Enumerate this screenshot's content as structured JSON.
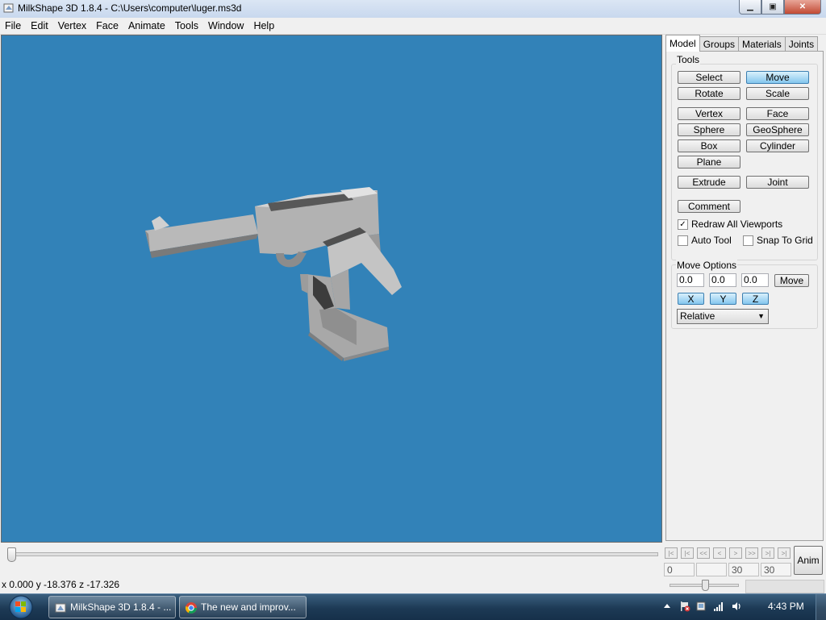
{
  "window": {
    "title": "MilkShape 3D 1.8.4 - C:\\Users\\computer\\luger.ms3d",
    "minimize_label": "▁",
    "maximize_label": "▣",
    "close_label": "✕"
  },
  "menu": [
    "File",
    "Edit",
    "Vertex",
    "Face",
    "Animate",
    "Tools",
    "Window",
    "Help"
  ],
  "panel": {
    "tabs": [
      "Model",
      "Groups",
      "Materials",
      "Joints"
    ],
    "active_tab": "Model",
    "tools_label": "Tools",
    "tool_buttons": {
      "select": "Select",
      "move": "Move",
      "rotate": "Rotate",
      "scale": "Scale",
      "vertex": "Vertex",
      "face": "Face",
      "sphere": "Sphere",
      "geosphere": "GeoSphere",
      "box": "Box",
      "cylinder": "Cylinder",
      "plane": "Plane",
      "extrude": "Extrude",
      "joint": "Joint",
      "comment": "Comment"
    },
    "active_tool": "Move",
    "redraw_all_viewports": {
      "label": "Redraw All Viewports",
      "checked": true,
      "mark": "✓"
    },
    "auto_tool": {
      "label": "Auto Tool",
      "checked": false
    },
    "snap_to_grid": {
      "label": "Snap To Grid",
      "checked": false
    },
    "move_options": {
      "label": "Move Options",
      "x_value": "0.0",
      "y_value": "0.0",
      "z_value": "0.0",
      "move_button": "Move",
      "x_toggle": "X",
      "y_toggle": "Y",
      "z_toggle": "Z",
      "mode": "Relative",
      "dropdown_arrow": "▼"
    }
  },
  "timeline": {
    "nav_buttons": [
      "|<",
      "|<",
      "<<",
      "<",
      ">",
      ">>",
      ">|",
      ">|"
    ],
    "current_frame": "0",
    "frame_fields": [
      "",
      "30",
      "30"
    ],
    "anim_button": "Anim"
  },
  "status": {
    "coords": "x 0.000 y -18.376 z -17.326"
  },
  "taskbar": {
    "tasks": [
      {
        "label": "MilkShape 3D 1.8.4 - ...",
        "icon": "milkshape-icon"
      },
      {
        "label": "The new and improv...",
        "icon": "chrome-icon"
      }
    ],
    "clock": "4:43 PM"
  },
  "colors": {
    "viewport_bg": "#3282b8",
    "active_button": "#84c6ee",
    "taskbar": "#1d3a55"
  }
}
